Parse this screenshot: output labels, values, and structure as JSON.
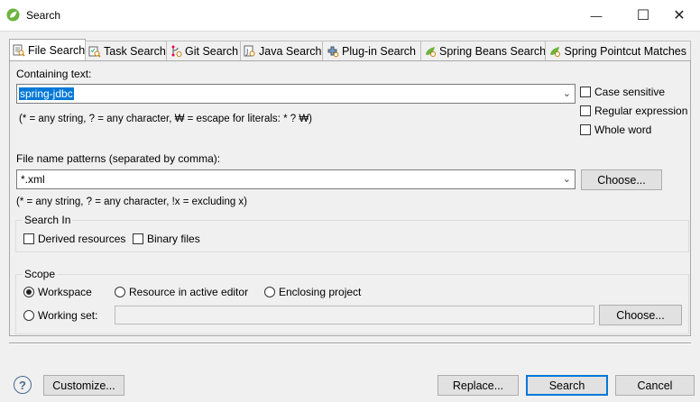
{
  "window": {
    "title": "Search",
    "minimize_glyph": "—",
    "maximize_glyph": "☐",
    "close_glyph": "✕"
  },
  "tabs": [
    {
      "label": "File Search",
      "icon": "file-search-icon",
      "active": true
    },
    {
      "label": "Task Search",
      "icon": "task-search-icon",
      "active": false
    },
    {
      "label": "Git Search",
      "icon": "git-search-icon",
      "active": false
    },
    {
      "label": "Java Search",
      "icon": "java-search-icon",
      "active": false
    },
    {
      "label": "Plug-in Search",
      "icon": "plugin-search-icon",
      "active": false
    },
    {
      "label": "Spring Beans Search",
      "icon": "spring-beans-search-icon",
      "active": false
    },
    {
      "label": "Spring Pointcut Matches",
      "icon": "spring-pointcut-icon",
      "active": false
    }
  ],
  "containing": {
    "label": "Containing text:",
    "value": "spring-jdbc",
    "hint": "(* = any string, ? = any character, ₩ = escape for literals: * ? ₩)",
    "options": {
      "case_sensitive": {
        "label": "Case sensitive",
        "checked": false
      },
      "regex": {
        "label": "Regular expression",
        "checked": false
      },
      "whole_word": {
        "label": "Whole word",
        "checked": false
      }
    }
  },
  "file_patterns": {
    "label": "File name patterns (separated by comma):",
    "value": "*.xml",
    "choose_label": "Choose...",
    "hint": "(* = any string, ? = any character, !x = excluding x)"
  },
  "search_in": {
    "title": "Search In",
    "derived": {
      "label": "Derived resources",
      "checked": false
    },
    "binary": {
      "label": "Binary files",
      "checked": false
    }
  },
  "scope": {
    "title": "Scope",
    "workspace": {
      "label": "Workspace",
      "selected": true
    },
    "active_editor": {
      "label": "Resource in active editor",
      "selected": false
    },
    "enclosing": {
      "label": "Enclosing project",
      "selected": false
    },
    "working_set": {
      "label": "Working set:",
      "selected": false,
      "value": ""
    },
    "choose_label": "Choose..."
  },
  "footer": {
    "help_glyph": "?",
    "customize_label": "Customize...",
    "replace_label": "Replace...",
    "search_label": "Search",
    "cancel_label": "Cancel"
  },
  "colors": {
    "accent": "#0078d7",
    "spring_green": "#6db33f"
  }
}
